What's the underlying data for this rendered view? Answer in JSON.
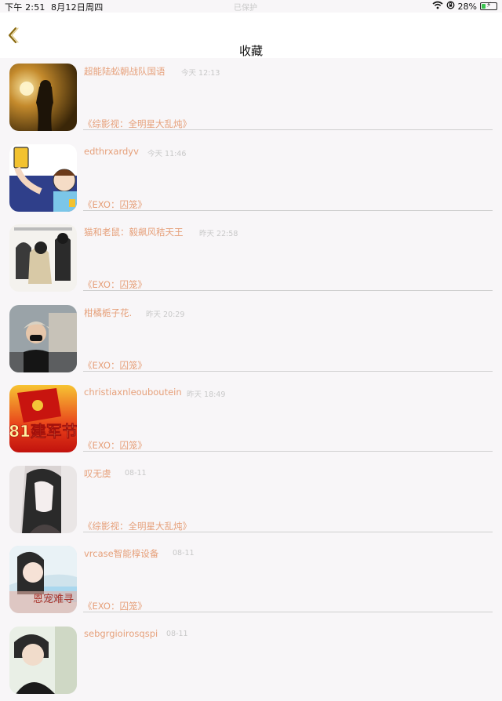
{
  "status_bar": {
    "time": "下午 2:51",
    "date": "8月12日周四",
    "center": "已保护",
    "battery": "28%",
    "battery_level": 0.28
  },
  "nav": {
    "title": "收藏"
  },
  "favorites": [
    {
      "username": "超能陆蚣朝战队国语",
      "time": "今天 12:13",
      "source": "《综影视：全明星大乱炖》"
    },
    {
      "username": "edthrxardyv",
      "time": "今天 11:46",
      "source": "《EXO：囚笼》"
    },
    {
      "username": "猫和老鼠：毅飙风秸天王",
      "time": "昨天 22:58",
      "source": "《EXO：囚笼》"
    },
    {
      "username": "柑橘栀子花.",
      "time": "昨天 20:29",
      "source": "《EXO：囚笼》"
    },
    {
      "username": "christiaxnleouboutein",
      "time": "昨天 18:49",
      "source": "《EXO：囚笼》"
    },
    {
      "username": "叹无虞",
      "time": "08-11",
      "source": "《综影视：全明星大乱炖》"
    },
    {
      "username": "vrcase智能椁设备",
      "time": "08-11",
      "source": "《EXO：囚笼》"
    },
    {
      "username": "sebgrgioirosqspi",
      "time": "08-11",
      "source": ""
    }
  ],
  "avatar_texts": {
    "item5": "81建军节",
    "item7": "恩宠难寻"
  }
}
